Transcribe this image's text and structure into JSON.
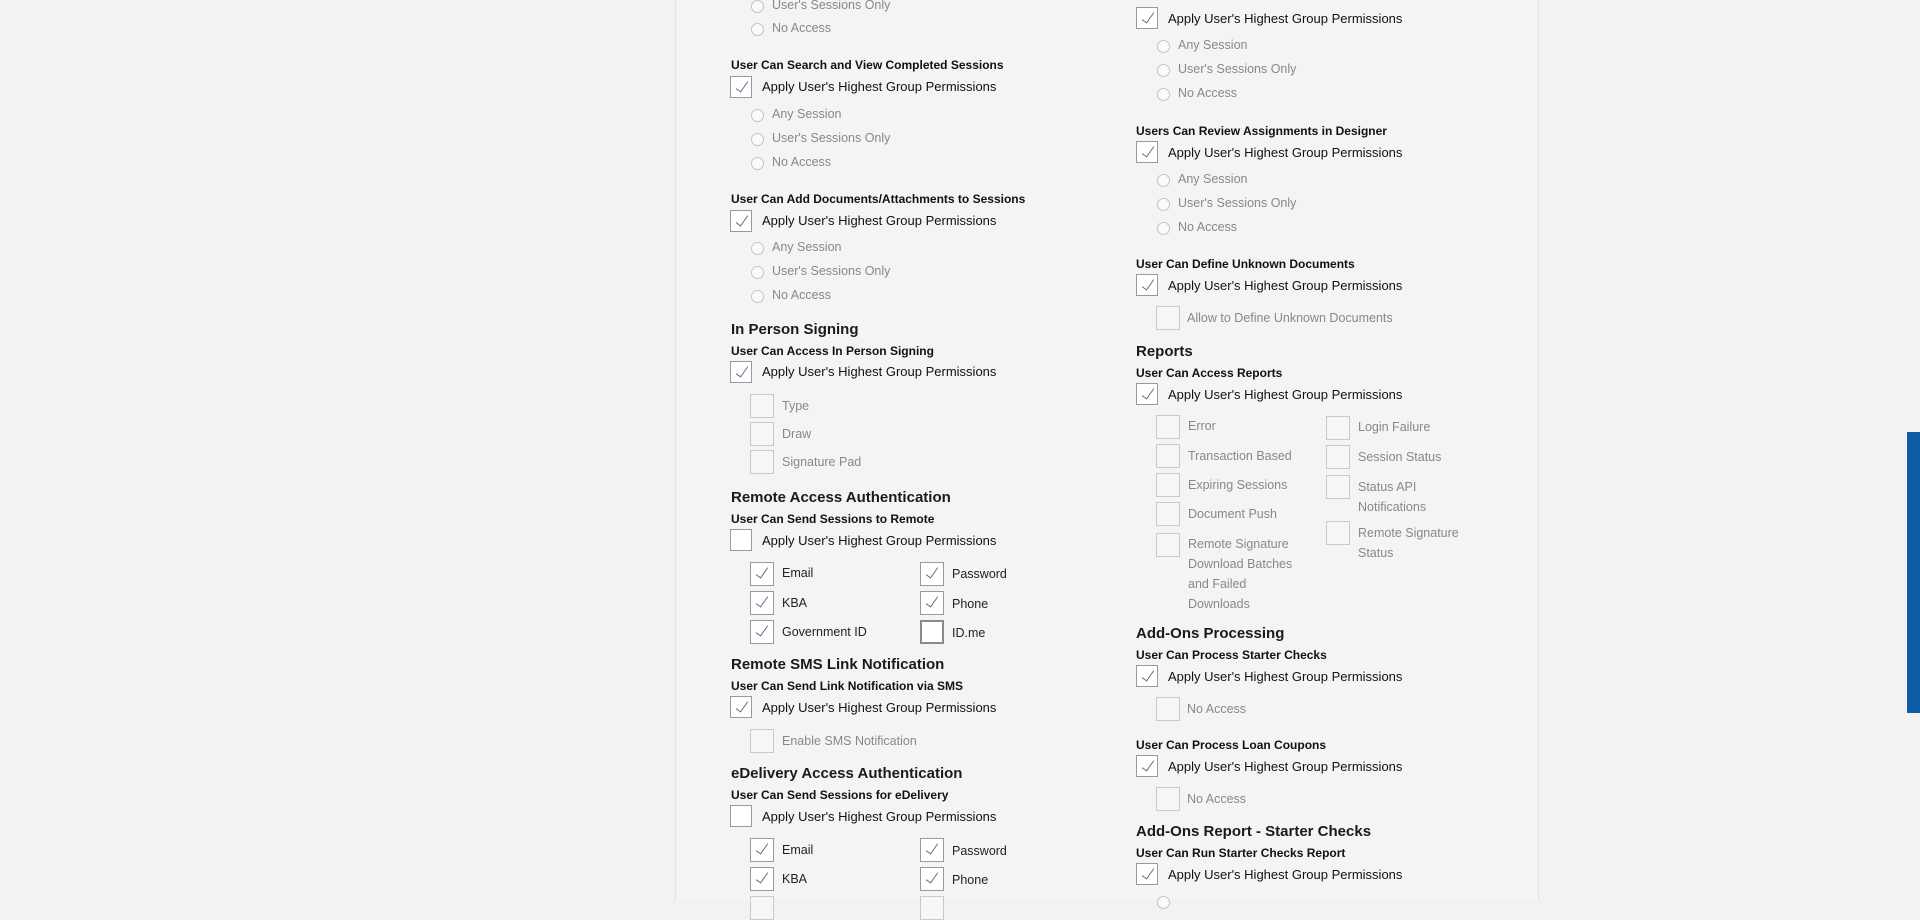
{
  "apply_label": "Apply User's Highest Group Permissions",
  "radio_options": {
    "any": "Any Session",
    "own": "User's Sessions Only",
    "none": "No Access"
  },
  "left": {
    "top_remnant": {
      "own": "User's Sessions Only",
      "none": "No Access"
    },
    "search_view": {
      "label": "User Can Search and View Completed Sessions"
    },
    "add_docs": {
      "label": "User Can Add Documents/Attachments to Sessions"
    },
    "in_person": {
      "title": "In Person Signing",
      "label": "User Can Access In Person Signing",
      "options": [
        "Type",
        "Draw",
        "Signature Pad"
      ]
    },
    "remote_auth": {
      "title": "Remote Access Authentication",
      "label": "User Can Send Sessions to Remote",
      "options": [
        {
          "label": "Email",
          "checked": true
        },
        {
          "label": "Password",
          "checked": true
        },
        {
          "label": "KBA",
          "checked": true
        },
        {
          "label": "Phone",
          "checked": true
        },
        {
          "label": "Government ID",
          "checked": true
        },
        {
          "label": "ID.me",
          "checked": false
        }
      ]
    },
    "sms": {
      "title": "Remote SMS Link Notification",
      "label": "User Can Send Link Notification via SMS",
      "option": "Enable SMS Notification"
    },
    "edelivery": {
      "title": "eDelivery Access Authentication",
      "label": "User Can Send Sessions for eDelivery",
      "options": [
        {
          "label": "Email",
          "checked": true
        },
        {
          "label": "Password",
          "checked": true
        },
        {
          "label": "KBA",
          "checked": true
        },
        {
          "label": "Phone",
          "checked": true
        }
      ]
    }
  },
  "right": {
    "review": {
      "label": "Users Can Review Assignments in Designer"
    },
    "define_unknown": {
      "label": "User Can Define Unknown Documents",
      "option": "Allow to Define Unknown Documents"
    },
    "reports": {
      "title": "Reports",
      "label": "User Can Access Reports",
      "col1": [
        "Error",
        "Transaction Based",
        "Expiring Sessions",
        "Document Push",
        "Remote Signature Download Batches and Failed Downloads"
      ],
      "col2": [
        "Login Failure",
        "Session Status",
        "Status API Notifications",
        "Remote Signature Status"
      ]
    },
    "addons": {
      "title": "Add-Ons Processing",
      "starter": {
        "label": "User Can Process Starter Checks",
        "option": "No Access"
      },
      "loan": {
        "label": "User Can Process Loan Coupons",
        "option": "No Access"
      }
    },
    "addons_report": {
      "title": "Add-Ons Report - Starter Checks",
      "label": "User Can Run Starter Checks Report"
    }
  }
}
